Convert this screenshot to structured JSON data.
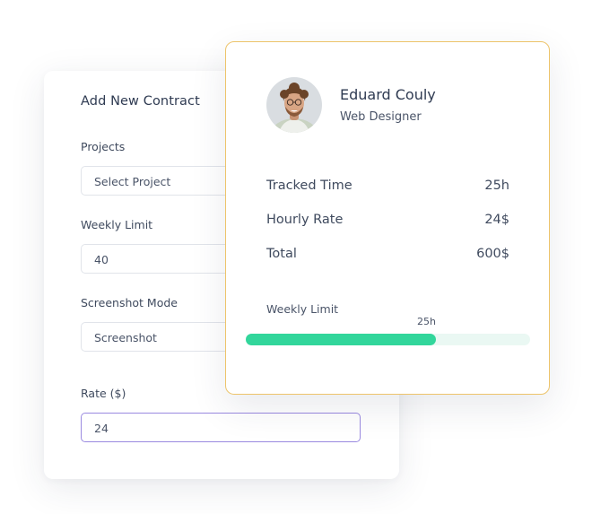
{
  "form": {
    "title": "Add New Contract",
    "fields": [
      {
        "label": "Projects",
        "value": "Select Project"
      },
      {
        "label": "Weekly Limit",
        "value": "40"
      },
      {
        "label": "Screenshot Mode",
        "value": "Screenshot"
      },
      {
        "label": "Rate ($)",
        "value": "24"
      }
    ]
  },
  "profile": {
    "name": "Eduard Couly",
    "role": "Web Designer",
    "stats": [
      {
        "label": "Tracked Time",
        "value": "25h"
      },
      {
        "label": "Hourly Rate",
        "value": "24$"
      },
      {
        "label": "Total",
        "value": "600$"
      }
    ],
    "weekly_limit": {
      "label": "Weekly Limit",
      "marker": "25h",
      "progress_fraction": 0.67
    }
  },
  "colors": {
    "progress_fill": "#32d69b",
    "progress_track": "#eaf8f3",
    "card_border": "#edc46b",
    "active_field_border": "#9a8ae0"
  }
}
